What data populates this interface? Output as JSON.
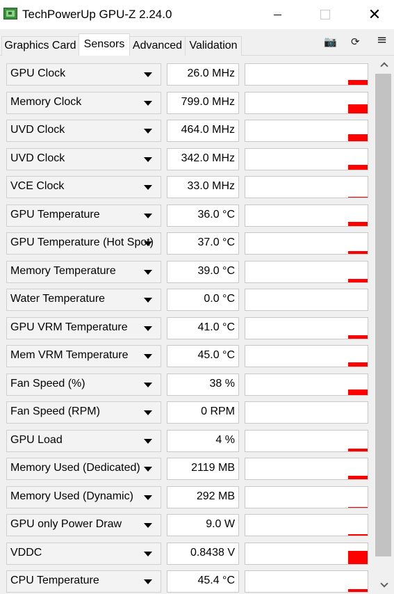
{
  "window": {
    "title": "TechPowerUp GPU-Z 2.24.0",
    "minimize": "—",
    "maximize": "□",
    "close": "✕"
  },
  "tabs": [
    {
      "label": "Graphics Card",
      "active": false
    },
    {
      "label": "Sensors",
      "active": true
    },
    {
      "label": "Advanced",
      "active": false
    },
    {
      "label": "Validation",
      "active": false
    }
  ],
  "toolbar": {
    "camera_icon": "camera-icon",
    "refresh_icon": "refresh-icon",
    "menu_icon": "menu-icon",
    "camera_glyph": "📷",
    "refresh_glyph": "⟳",
    "menu_glyph": "≡"
  },
  "accent_color": "#ff0000",
  "sensors": [
    {
      "label": "GPU Clock",
      "value": "26.0 MHz",
      "graph_level": 0.3
    },
    {
      "label": "Memory Clock",
      "value": "799.0 MHz",
      "graph_level": 0.55
    },
    {
      "label": "UVD Clock",
      "value": "464.0 MHz",
      "graph_level": 0.4
    },
    {
      "label": "UVD Clock",
      "value": "342.0 MHz",
      "graph_level": 0.3
    },
    {
      "label": "VCE Clock",
      "value": "33.0 MHz",
      "graph_level": 0.05
    },
    {
      "label": "GPU Temperature",
      "value": "36.0 °C",
      "graph_level": 0.25
    },
    {
      "label": "GPU Temperature (Hot Spot)",
      "value": "37.0 °C",
      "graph_level": 0.18
    },
    {
      "label": "Memory Temperature",
      "value": "39.0 °C",
      "graph_level": 0.2
    },
    {
      "label": "Water Temperature",
      "value": "0.0 °C",
      "graph_level": 0
    },
    {
      "label": "GPU VRM Temperature",
      "value": "41.0 °C",
      "graph_level": 0.2
    },
    {
      "label": "Mem VRM Temperature",
      "value": "45.0 °C",
      "graph_level": 0.25
    },
    {
      "label": "Fan Speed (%)",
      "value": "38 %",
      "graph_level": 0.35
    },
    {
      "label": "Fan Speed (RPM)",
      "value": "0 RPM",
      "graph_level": 0
    },
    {
      "label": "GPU Load",
      "value": "4 %",
      "graph_level": 0.15
    },
    {
      "label": "Memory Used (Dedicated)",
      "value": "2119 MB",
      "graph_level": 0.2
    },
    {
      "label": "Memory Used (Dynamic)",
      "value": "292 MB",
      "graph_level": 0.05
    },
    {
      "label": "GPU only Power Draw",
      "value": "9.0 W",
      "graph_level": 0.08
    },
    {
      "label": "VDDC",
      "value": "0.8438 V",
      "graph_level": 0.8
    },
    {
      "label": "CPU Temperature",
      "value": "45.4 °C",
      "graph_level": 0.15
    }
  ]
}
